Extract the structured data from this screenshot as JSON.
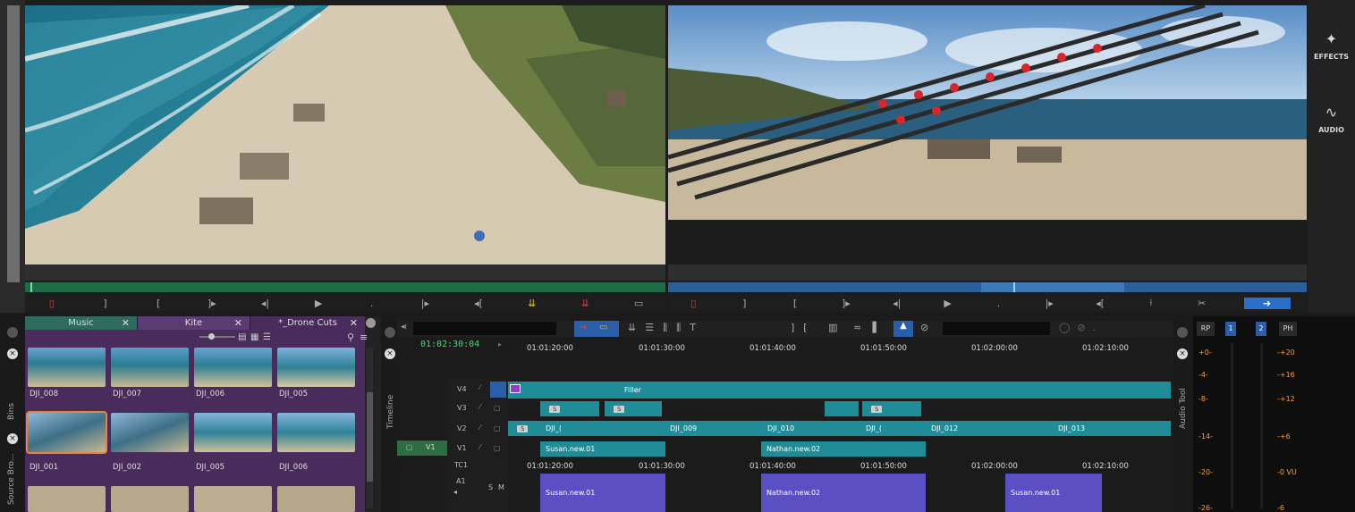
{
  "right_panel": {
    "effects_label": "EFFECTS",
    "audio_label": "AUDIO"
  },
  "bins": {
    "tabs": [
      {
        "label": "Music"
      },
      {
        "label": "Kite"
      },
      {
        "label": "*_Drone Cuts"
      }
    ],
    "row1_labels": [
      "DJI_008",
      "DJI_007",
      "DJI_006",
      "DJI_005"
    ],
    "row2_labels": [
      "DJI_001",
      "DJI_002",
      "DJI_005",
      "DJI_006"
    ],
    "side_labels": [
      "Bins",
      "Source Bro..."
    ]
  },
  "timeline": {
    "side_label": "Timeline",
    "current_tc": "01:02:30:04",
    "ruler": [
      "01:01:20:00",
      "01:01:30:00",
      "01:01:40:00",
      "01:01:50:00",
      "01:02:00:00",
      "01:02:10:00"
    ],
    "tracks": {
      "v4": "V4",
      "v3": "V3",
      "v2": "V2",
      "v1": "V1",
      "v1_src": "V1",
      "tc1": "TC1",
      "a1": "A1",
      "a1_s": "S",
      "a1_m": "M"
    },
    "clips": {
      "filler": "Filler",
      "v2_dji_1": "DJI_(",
      "v2_dji_009": "DJI_009",
      "v2_dji_010": "DJI_010",
      "v2_dji_c": "DJI_(",
      "v2_dji_012": "DJI_012",
      "v2_dji_013": "DJI_013",
      "v1_susan": "Susan.new.01",
      "v1_nathan": "Nathan.new.02",
      "a1_susan": "Susan.new.01",
      "a1_nathan": "Nathan.new.02",
      "a1_susan2": "Susan.new.01",
      "s_badge": "S"
    }
  },
  "audio_tool": {
    "side_label": "Audio Tool",
    "header": [
      "RP",
      "PH"
    ],
    "ch1": "1",
    "ch2": "2",
    "left_scale": [
      "+0-",
      "-4-",
      "-8-",
      "-14-",
      "-20-",
      "-26-"
    ],
    "right_scale": [
      "-+20",
      "-+16",
      "-+12",
      "-+6",
      "-0 VU",
      "-6"
    ]
  },
  "colors": {
    "teal_clip": "#1f8c97",
    "purple_clip": "#5b4fc4",
    "bin_purple": "#4a2c5c",
    "tc_green": "#3fdc6c",
    "playhead_red": "#e53935"
  }
}
